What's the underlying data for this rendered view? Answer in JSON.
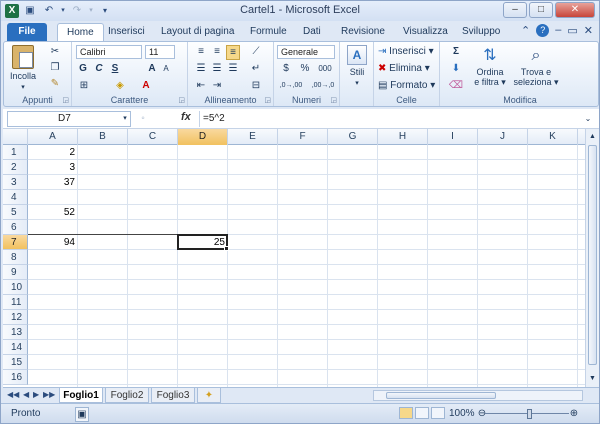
{
  "titlebar": {
    "app_icon": "X",
    "title": "Cartel1  -  Microsoft Excel"
  },
  "tabs": [
    "File",
    "Home",
    "Inserisci",
    "Layout di pagina",
    "Formule",
    "Dati",
    "Revisione",
    "Visualizza",
    "Sviluppo"
  ],
  "ribbon": {
    "appunti": {
      "label": "Appunti",
      "incolla": "Incolla"
    },
    "carattere": {
      "label": "Carattere",
      "font": "Calibri",
      "size": "11",
      "bold": "G",
      "italic": "C",
      "underline": "S",
      "grow": "A",
      "shrink": "A"
    },
    "allineamento": {
      "label": "Allineamento"
    },
    "numeri": {
      "label": "Numeri",
      "format": "Generale",
      "currency": "$",
      "percent": "%",
      "thousands": "000",
      "inc": ",0→,00",
      "dec": ",00→,0"
    },
    "stili": {
      "label": "Stili"
    },
    "celle": {
      "label": "Celle",
      "inserisci": "Inserisci",
      "elimina": "Elimina",
      "formato": "Formato"
    },
    "modifica": {
      "label": "Modifica",
      "ordina_1": "Ordina",
      "ordina_2": "e filtra",
      "trova_1": "Trova e",
      "trova_2": "seleziona",
      "sigma": "Σ"
    }
  },
  "formula_bar": {
    "name_box": "D7",
    "fx": "fx",
    "formula": "=5^2"
  },
  "columns": [
    "A",
    "B",
    "C",
    "D",
    "E",
    "F",
    "G",
    "H",
    "I",
    "J",
    "K"
  ],
  "rows": [
    "1",
    "2",
    "3",
    "4",
    "5",
    "6",
    "7",
    "8",
    "9",
    "10",
    "11",
    "12",
    "13",
    "14",
    "15",
    "16"
  ],
  "cells": {
    "A1": "2",
    "A2": "3",
    "A3": "37",
    "A5": "52",
    "A7": "94",
    "D7": "25"
  },
  "sheets": [
    "Foglio1",
    "Foglio2",
    "Foglio3"
  ],
  "status": {
    "ready": "Pronto",
    "zoom": "100%"
  }
}
